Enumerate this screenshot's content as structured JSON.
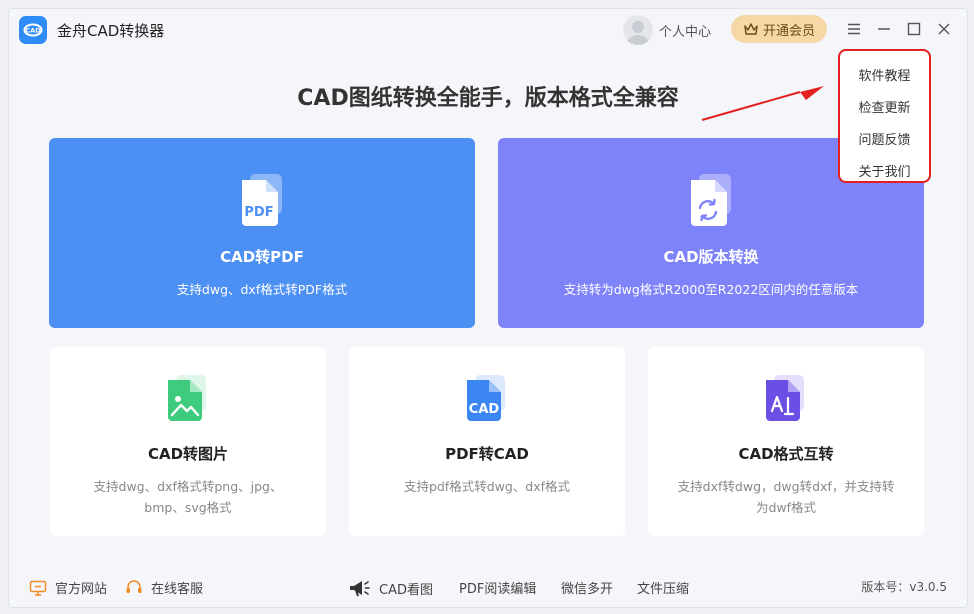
{
  "window": {
    "title": "金舟CAD转换器"
  },
  "header": {
    "user_center": "个人中心",
    "vip_button": "开通会员"
  },
  "slogan": "CAD图纸转换全能手，版本格式全兼容",
  "cards_big": [
    {
      "title": "CAD转PDF",
      "desc": "支持dwg、dxf格式转PDF格式",
      "icon": "pdf-file-icon"
    },
    {
      "title": "CAD版本转换",
      "desc": "支持转为dwg格式R2000至R2022区间内的任意版本",
      "icon": "version-convert-icon"
    }
  ],
  "cards_small": [
    {
      "title": "CAD转图片",
      "desc": "支持dwg、dxf格式转png、jpg、bmp、svg格式",
      "icon": "image-file-icon"
    },
    {
      "title": "PDF转CAD",
      "desc": "支持pdf格式转dwg、dxf格式",
      "icon": "cad-file-icon"
    },
    {
      "title": "CAD格式互转",
      "desc": "支持dxf转dwg，dwg转dxf，并支持转为dwf格式",
      "icon": "format-convert-icon"
    }
  ],
  "footer": {
    "website": "官方网站",
    "service": "在线客服",
    "links": [
      "CAD看图",
      "PDF阅读编辑",
      "微信多开",
      "文件压缩"
    ],
    "version": "版本号：v3.0.5"
  },
  "menu": {
    "items": [
      "软件教程",
      "检查更新",
      "问题反馈",
      "关于我们"
    ]
  },
  "colors": {
    "primary_blue": "#4d90f3",
    "purple": "#7e83f9",
    "vip_gold": "#f6d7a6",
    "highlight_red": "#e32020"
  }
}
